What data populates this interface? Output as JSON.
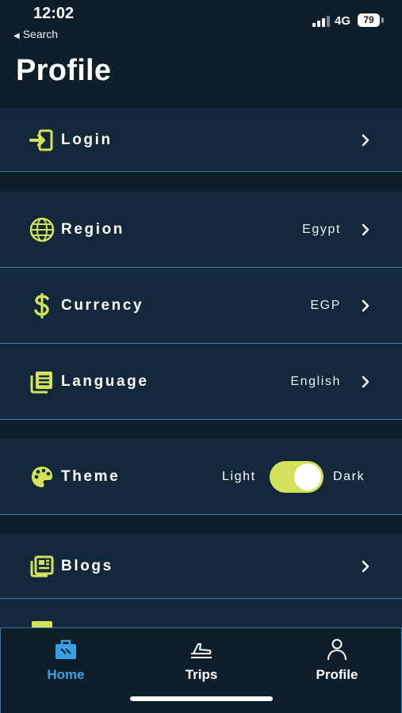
{
  "status_bar": {
    "time": "12:02",
    "back_label": "Search",
    "network": "4G",
    "battery": "79"
  },
  "header": {
    "title": "Profile"
  },
  "menu": {
    "login": {
      "label": "Login"
    },
    "region": {
      "label": "Region",
      "value": "Egypt"
    },
    "currency": {
      "label": "Currency",
      "value": "EGP"
    },
    "language": {
      "label": "Language",
      "value": "English"
    },
    "theme": {
      "label": "Theme",
      "option_left": "Light",
      "option_right": "Dark",
      "selected": "Dark"
    },
    "blogs": {
      "label": "Blogs"
    }
  },
  "tab_bar": {
    "active_tab": "Home",
    "tabs": [
      {
        "label": "Home",
        "icon": "home-luggage-icon"
      },
      {
        "label": "Trips",
        "icon": "plane-icon"
      },
      {
        "label": "Profile",
        "icon": "person-icon"
      }
    ]
  },
  "colors": {
    "accent": "#d4e25a",
    "active_tab": "#3aa0e6",
    "background": "#0f1e2b",
    "row_background": "#13283a",
    "divider": "#3a7aa6"
  }
}
